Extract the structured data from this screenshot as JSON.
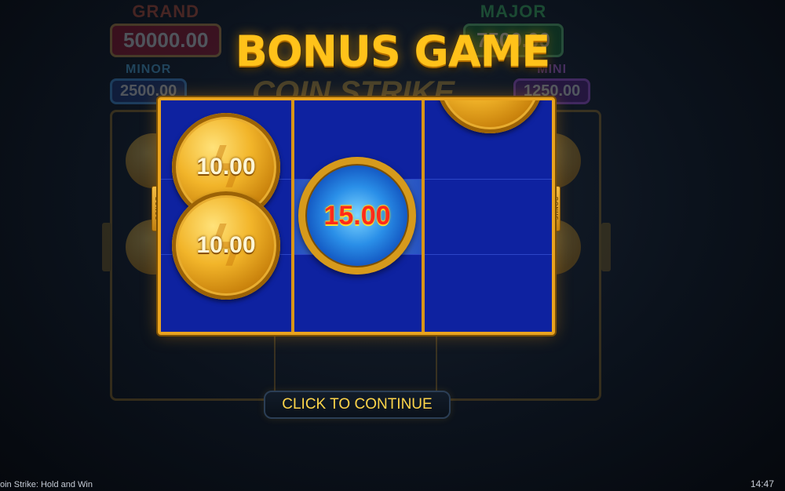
{
  "background": {
    "jackpots": {
      "grand": {
        "label": "GRAND",
        "value": "50000.00"
      },
      "major": {
        "label": "MAJOR",
        "value": "7500.00"
      },
      "minor": {
        "label": "MINOR",
        "value": "2500.00"
      },
      "mini": {
        "label": "MINI",
        "value": "1250.00"
      }
    },
    "logo": "COIN STRIKE"
  },
  "title": "BONUS GAME",
  "reels": {
    "coins": [
      {
        "value": "10.00",
        "type": "gold"
      },
      {
        "value": "10.00",
        "type": "gold"
      },
      {
        "value": "15.00",
        "type": "blue-lightning"
      },
      {
        "value": "",
        "type": "gold-partial"
      }
    ],
    "side_tab_label": "BONUS"
  },
  "continue_button": {
    "label": "CLICK TO CONTINUE"
  },
  "status_bar": {
    "game_name": "oin Strike: Hold and Win",
    "time": "14:47"
  },
  "colors": {
    "title": "#ffc21a",
    "reel_bg": "#0e22a0",
    "frame": "#e9a31f",
    "button_text": "#ffd54a"
  }
}
